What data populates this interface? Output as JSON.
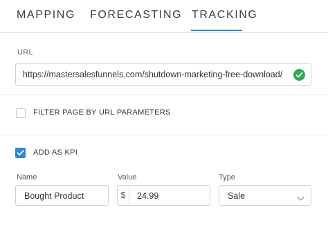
{
  "tabs": [
    {
      "label": "MAPPING"
    },
    {
      "label": "FORECASTING"
    },
    {
      "label": "TRACKING",
      "active": true
    }
  ],
  "url_section": {
    "label": "URL",
    "value": "https://mastersalesfunnels.com/shutdown-marketing-free-download/",
    "status_icon": "check-circle-icon"
  },
  "filter": {
    "checked": false,
    "label": "FILTER PAGE BY URL PARAMETERS"
  },
  "kpi": {
    "checked": true,
    "label": "ADD AS KPI",
    "fields": {
      "name_label": "Name",
      "name_value": "Bought Product",
      "value_label": "Value",
      "currency": "$",
      "value_value": "24.99",
      "type_label": "Type",
      "type_value": "Sale"
    }
  },
  "colors": {
    "accent": "#2a89d8",
    "success": "#2dab4f"
  }
}
